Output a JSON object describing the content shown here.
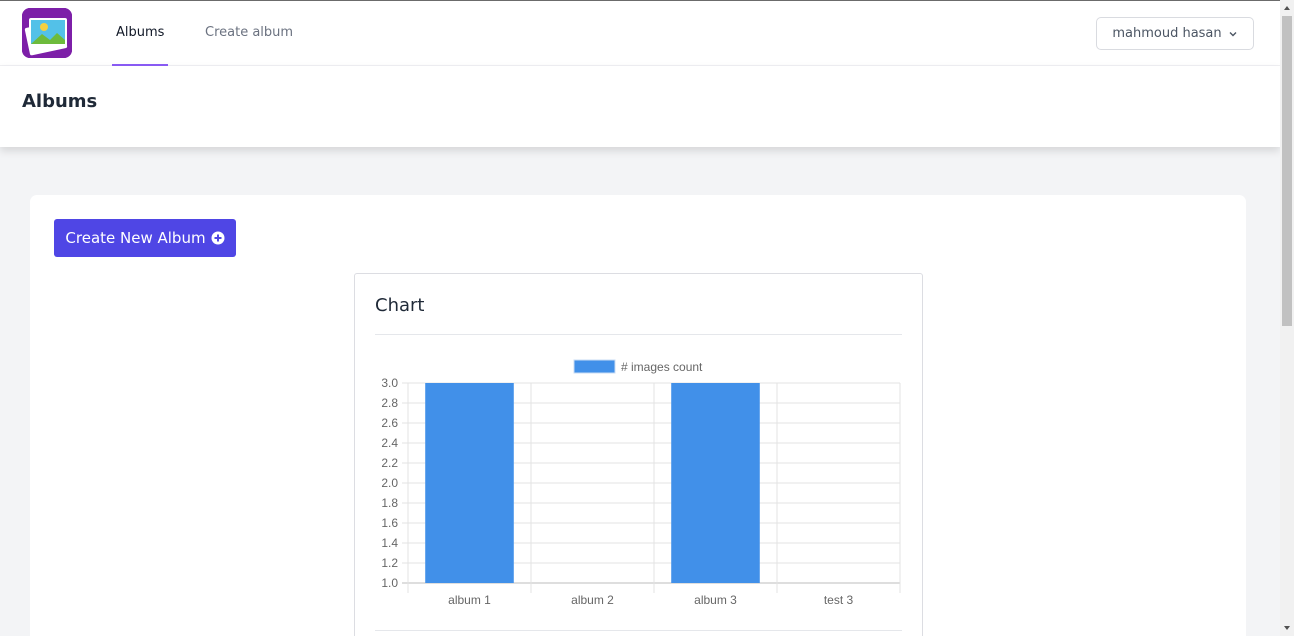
{
  "nav": {
    "links": [
      {
        "label": "Albums",
        "active": true
      },
      {
        "label": "Create album",
        "active": false
      }
    ],
    "user": {
      "name": "mahmoud hasan"
    }
  },
  "header": {
    "title": "Albums"
  },
  "content": {
    "create_button_label": "Create New Album"
  },
  "chart_card": {
    "title": "Chart"
  },
  "colors": {
    "accent": "#4f46e5",
    "tab_underline": "#8b5cf6",
    "bar": "#4190e9"
  },
  "chart_data": {
    "type": "bar",
    "categories": [
      "album 1",
      "album 2",
      "album 3",
      "test 3"
    ],
    "series": [
      {
        "name": "# images count",
        "values": [
          3,
          1,
          3,
          1
        ]
      }
    ],
    "ylim": [
      1.0,
      3.0
    ],
    "yticks": [
      "3.0",
      "2.8",
      "2.6",
      "2.4",
      "2.2",
      "2.0",
      "1.8",
      "1.6",
      "1.4",
      "1.2",
      "1.0"
    ],
    "grid": true,
    "legend": "top-center"
  }
}
